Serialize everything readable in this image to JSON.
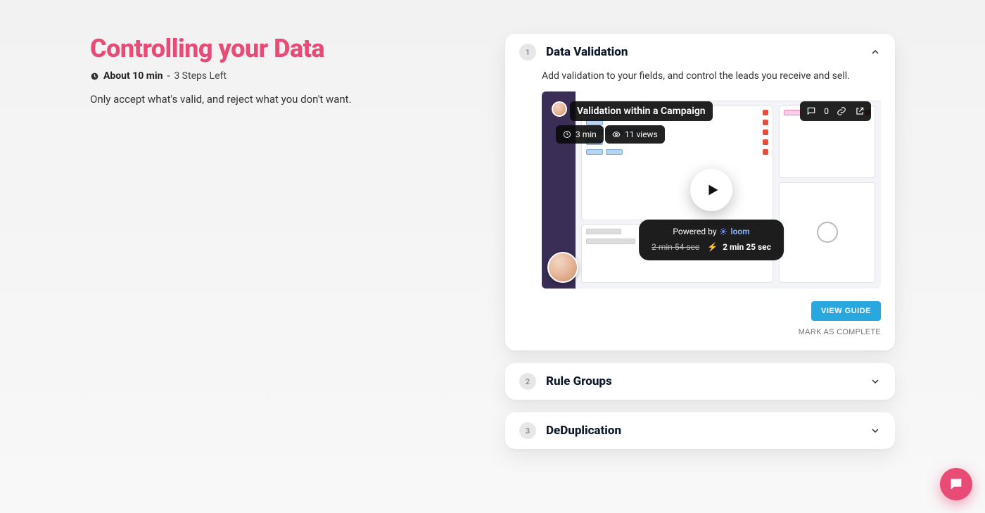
{
  "page": {
    "title": "Controlling your Data",
    "about": "About 10 min",
    "separator": " - ",
    "steps_left": "3 Steps Left",
    "intro": "Only accept what's valid, and reject what you don't want."
  },
  "steps": [
    {
      "num": "1",
      "title": "Data Validation",
      "subtitle": "Add validation to your fields, and control the leads you receive and sell.",
      "expanded": true,
      "video": {
        "title": "Validation within a Campaign",
        "duration": "3 min",
        "views": "11 views",
        "comments": "0",
        "powered_by_prefix": "Powered by ",
        "powered_by_brand": "loom",
        "old_time": "2 min 54 sec",
        "bolt": "⚡",
        "new_time": "2 min 25 sec"
      },
      "actions": {
        "view_guide": "VIEW GUIDE",
        "mark_complete": "MARK AS COMPLETE"
      }
    },
    {
      "num": "2",
      "title": "Rule Groups",
      "expanded": false
    },
    {
      "num": "3",
      "title": "DeDuplication",
      "expanded": false
    }
  ],
  "colors": {
    "accent": "#e94b77",
    "primary_button": "#29a8e0"
  }
}
